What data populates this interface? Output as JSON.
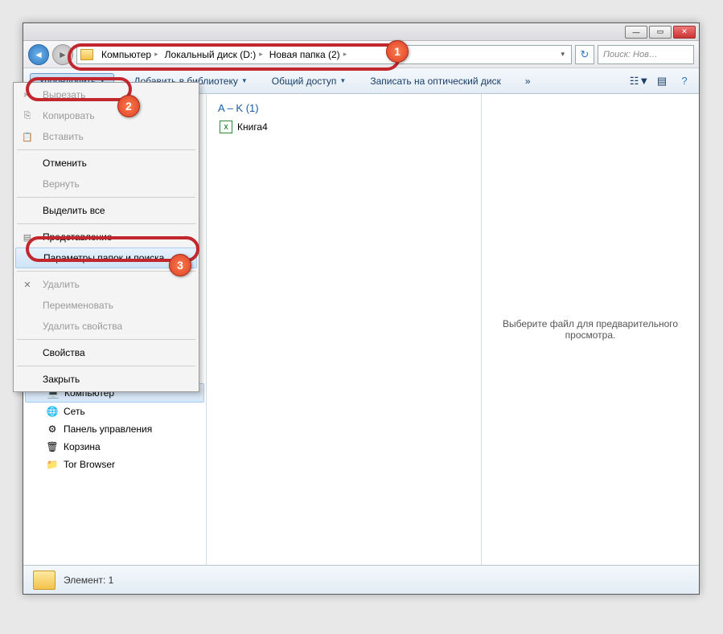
{
  "titlebar": {
    "min": "—",
    "max": "▭",
    "close": "✕"
  },
  "nav": {
    "back": "◄",
    "fwd": "►"
  },
  "breadcrumb": {
    "items": [
      "Компьютер",
      "Локальный диск (D:)",
      "Новая папка (2)"
    ],
    "sep": "▸"
  },
  "address_dropdown": "▾",
  "refresh": "↻",
  "search": {
    "placeholder": "Поиск: Нов…"
  },
  "toolbar": {
    "organize": "Упорядочить",
    "library": "Добавить в библиотеку",
    "share": "Общий доступ",
    "burn": "Записать на оптический диск",
    "more": "»",
    "dd": "▼",
    "help": "?"
  },
  "menu": {
    "cut": "Вырезать",
    "copy": "Копировать",
    "paste": "Вставить",
    "undo": "Отменить",
    "redo": "Вернуть",
    "select_all": "Выделить все",
    "layout": "Представление",
    "folder_options": "Параметры папок и поиска",
    "delete": "Удалить",
    "rename": "Переименовать",
    "remove_props": "Удалить свойства",
    "properties": "Свойства",
    "close": "Закрыть",
    "arrow": "▸"
  },
  "sidebar": {
    "computer": "Компьютер",
    "network": "Сеть",
    "control_panel": "Панель управления",
    "recycle": "Корзина",
    "tor": "Tor Browser"
  },
  "files": {
    "group": "A – K (1)",
    "book": "Книга4"
  },
  "preview_msg": "Выберите файл для предварительного просмотра.",
  "status": "Элемент: 1",
  "badges": {
    "b1": "1",
    "b2": "2",
    "b3": "3"
  }
}
